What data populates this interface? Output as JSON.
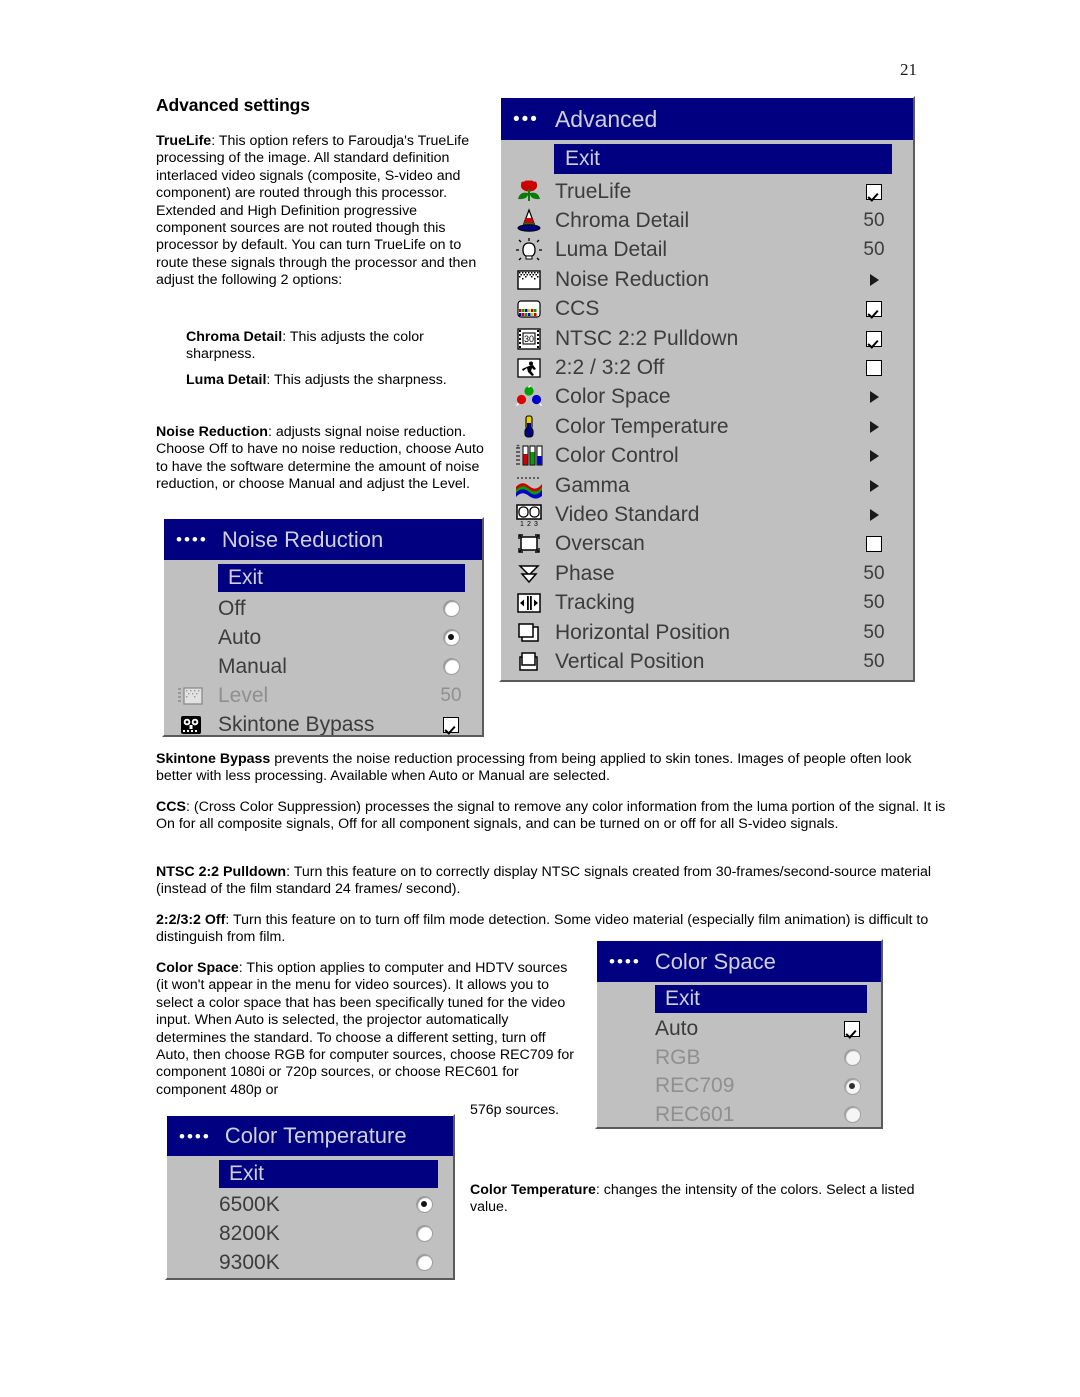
{
  "page": {
    "number": "21",
    "title": "Advanced settings"
  },
  "paragraphs": {
    "truelife": "TrueLife: This option refers to Faroudja's TrueLife processing of the image. All standard definition interlaced video signals (composite, S-video and component) are routed through this processor.  Extended and High Definition progressive component sources are not routed though this processor by default.  You can turn TrueLife on to route these signals through the processor and then adjust the following 2 options:",
    "truelife_bold": "TrueLife",
    "chroma_detail": "Chroma Detail: This adjusts the color sharpness.",
    "chroma_detail_bold": "Chroma Detail",
    "luma_detail": "Luma Detail: This adjusts the sharpness.",
    "luma_detail_bold": "Luma Detail",
    "noise_reduction": "Noise Reduction: adjusts signal noise reduction. Choose Off to have no noise reduction, choose Auto to have the software determine the amount of noise reduction, or choose Manual and adjust the Level.",
    "noise_reduction_bold": "Noise Reduction",
    "skintone_bypass": "Skintone Bypass prevents the noise reduction processing from being applied to skin tones. Images of people often look better with less processing. Available when Auto or Manual are selected.",
    "skintone_bypass_bold": "Skintone Bypass",
    "ccs": "CCS: (Cross Color Suppression) processes the signal to remove any color information from the luma portion of the signal. It is On for all composite signals, Off for all component signals, and can be turned on or off for all  S-video signals.",
    "ccs_bold": "CCS",
    "ntsc": "NTSC 2:2 Pulldown: Turn this feature on to correctly display NTSC signals created from 30-frames/second-source material (instead of the film standard 24 frames/ second).",
    "ntsc_bold": "NTSC 2:2 Pulldown",
    "film_off": "2:2/3:2 Off: Turn this feature on to turn off film mode detection. Some video material (especially film animation) is difficult to distinguish from film.",
    "film_off_bold": "2:2/3:2 Off",
    "color_space": "Color Space: This option applies to computer and HDTV sources (it won't appear in the menu for video sources). It allows you to select a color space that has been specifically tuned for the video input. When Auto is selected, the projector automatically determines the standard. To choose a different setting, turn off Auto, then choose RGB for computer sources, choose REC709 for component 1080i or 720p sources, or choose REC601 for component 480p or",
    "color_space_bold": "Color Space",
    "color_space_tail": "576p sources.",
    "color_temperature": "Color Temperature: changes the intensity of the colors. Select a listed value.",
    "color_temperature_bold": "Color Temperature"
  },
  "colors": {
    "menu_background": "#c0c0c0",
    "menu_header": "#000080",
    "menu_header_text": "#d0d0d8",
    "menu_label": "#3c3c3c",
    "menu_label_disabled": "#909090"
  },
  "menus": {
    "advanced": {
      "title": "Advanced",
      "dots": "•••",
      "exit": "Exit",
      "rows": [
        {
          "icon": "tulip-flower-icon",
          "label": "TrueLife",
          "control": "checkbox",
          "checked": true,
          "value": ""
        },
        {
          "icon": "color-cone-icon",
          "label": "Chroma Detail",
          "control": "number",
          "checked": false,
          "value": "50"
        },
        {
          "icon": "light-bulb-icon",
          "label": "Luma Detail",
          "control": "number",
          "checked": false,
          "value": "50"
        },
        {
          "icon": "noise-screen-icon",
          "label": "Noise Reduction",
          "control": "submenu",
          "checked": false,
          "value": ""
        },
        {
          "icon": "color-bars-icon",
          "label": "CCS",
          "control": "checkbox",
          "checked": true,
          "value": ""
        },
        {
          "icon": "film-frame-30-icon",
          "label": "NTSC 2:2 Pulldown",
          "control": "checkbox",
          "checked": true,
          "value": ""
        },
        {
          "icon": "running-man-icon",
          "label": "2:2 / 3:2 Off",
          "control": "checkbox",
          "checked": false,
          "value": ""
        },
        {
          "icon": "rgb-balls-icon",
          "label": "Color Space",
          "control": "submenu",
          "checked": false,
          "value": ""
        },
        {
          "icon": "thermometer-icon",
          "label": "Color Temperature",
          "control": "submenu",
          "checked": false,
          "value": ""
        },
        {
          "icon": "rgb-sliders-icon",
          "label": "Color Control",
          "control": "submenu",
          "checked": false,
          "value": ""
        },
        {
          "icon": "gamma-curve-icon",
          "label": "Gamma",
          "control": "submenu",
          "checked": false,
          "value": ""
        },
        {
          "icon": "video-standard-icon",
          "label": "Video Standard",
          "control": "submenu",
          "checked": false,
          "value": ""
        },
        {
          "icon": "overscan-icon",
          "label": "Overscan",
          "control": "checkbox",
          "checked": false,
          "value": ""
        },
        {
          "icon": "phase-icon",
          "label": "Phase",
          "control": "number",
          "checked": false,
          "value": "50"
        },
        {
          "icon": "tracking-icon",
          "label": "Tracking",
          "control": "number",
          "checked": false,
          "value": "50"
        },
        {
          "icon": "horizontal-position-icon",
          "label": "Horizontal Position",
          "control": "number",
          "checked": false,
          "value": "50"
        },
        {
          "icon": "vertical-position-icon",
          "label": "Vertical Position",
          "control": "number",
          "checked": false,
          "value": "50"
        }
      ]
    },
    "noise_reduction": {
      "title": "Noise Reduction",
      "dots": "••••",
      "exit": "Exit",
      "rows": [
        {
          "icon": "",
          "label": "Off",
          "control": "radio",
          "checked": false,
          "value": "",
          "disabled": false
        },
        {
          "icon": "",
          "label": "Auto",
          "control": "radio",
          "checked": true,
          "value": "",
          "disabled": false
        },
        {
          "icon": "",
          "label": "Manual",
          "control": "radio",
          "checked": false,
          "value": "",
          "disabled": false
        },
        {
          "icon": "noise-level-icon",
          "label": "Level",
          "control": "number",
          "checked": false,
          "value": "50",
          "disabled": true
        },
        {
          "icon": "skintone-face-icon",
          "label": "Skintone Bypass",
          "control": "checkbox",
          "checked": true,
          "value": "",
          "disabled": false
        }
      ]
    },
    "color_space": {
      "title": "Color Space",
      "dots": "••••",
      "exit": "Exit",
      "rows": [
        {
          "label": "Auto",
          "control": "checkbox",
          "checked": true,
          "disabled": false
        },
        {
          "label": "RGB",
          "control": "radio",
          "checked": false,
          "disabled": true
        },
        {
          "label": "REC709",
          "control": "radio",
          "checked": true,
          "disabled": true
        },
        {
          "label": "REC601",
          "control": "radio",
          "checked": false,
          "disabled": true
        }
      ]
    },
    "color_temperature": {
      "title": "Color Temperature",
      "dots": "••••",
      "exit": "Exit",
      "rows": [
        {
          "label": "6500K",
          "control": "radio",
          "checked": true,
          "disabled": false
        },
        {
          "label": "8200K",
          "control": "radio",
          "checked": false,
          "disabled": false
        },
        {
          "label": "9300K",
          "control": "radio",
          "checked": false,
          "disabled": false
        }
      ]
    }
  }
}
